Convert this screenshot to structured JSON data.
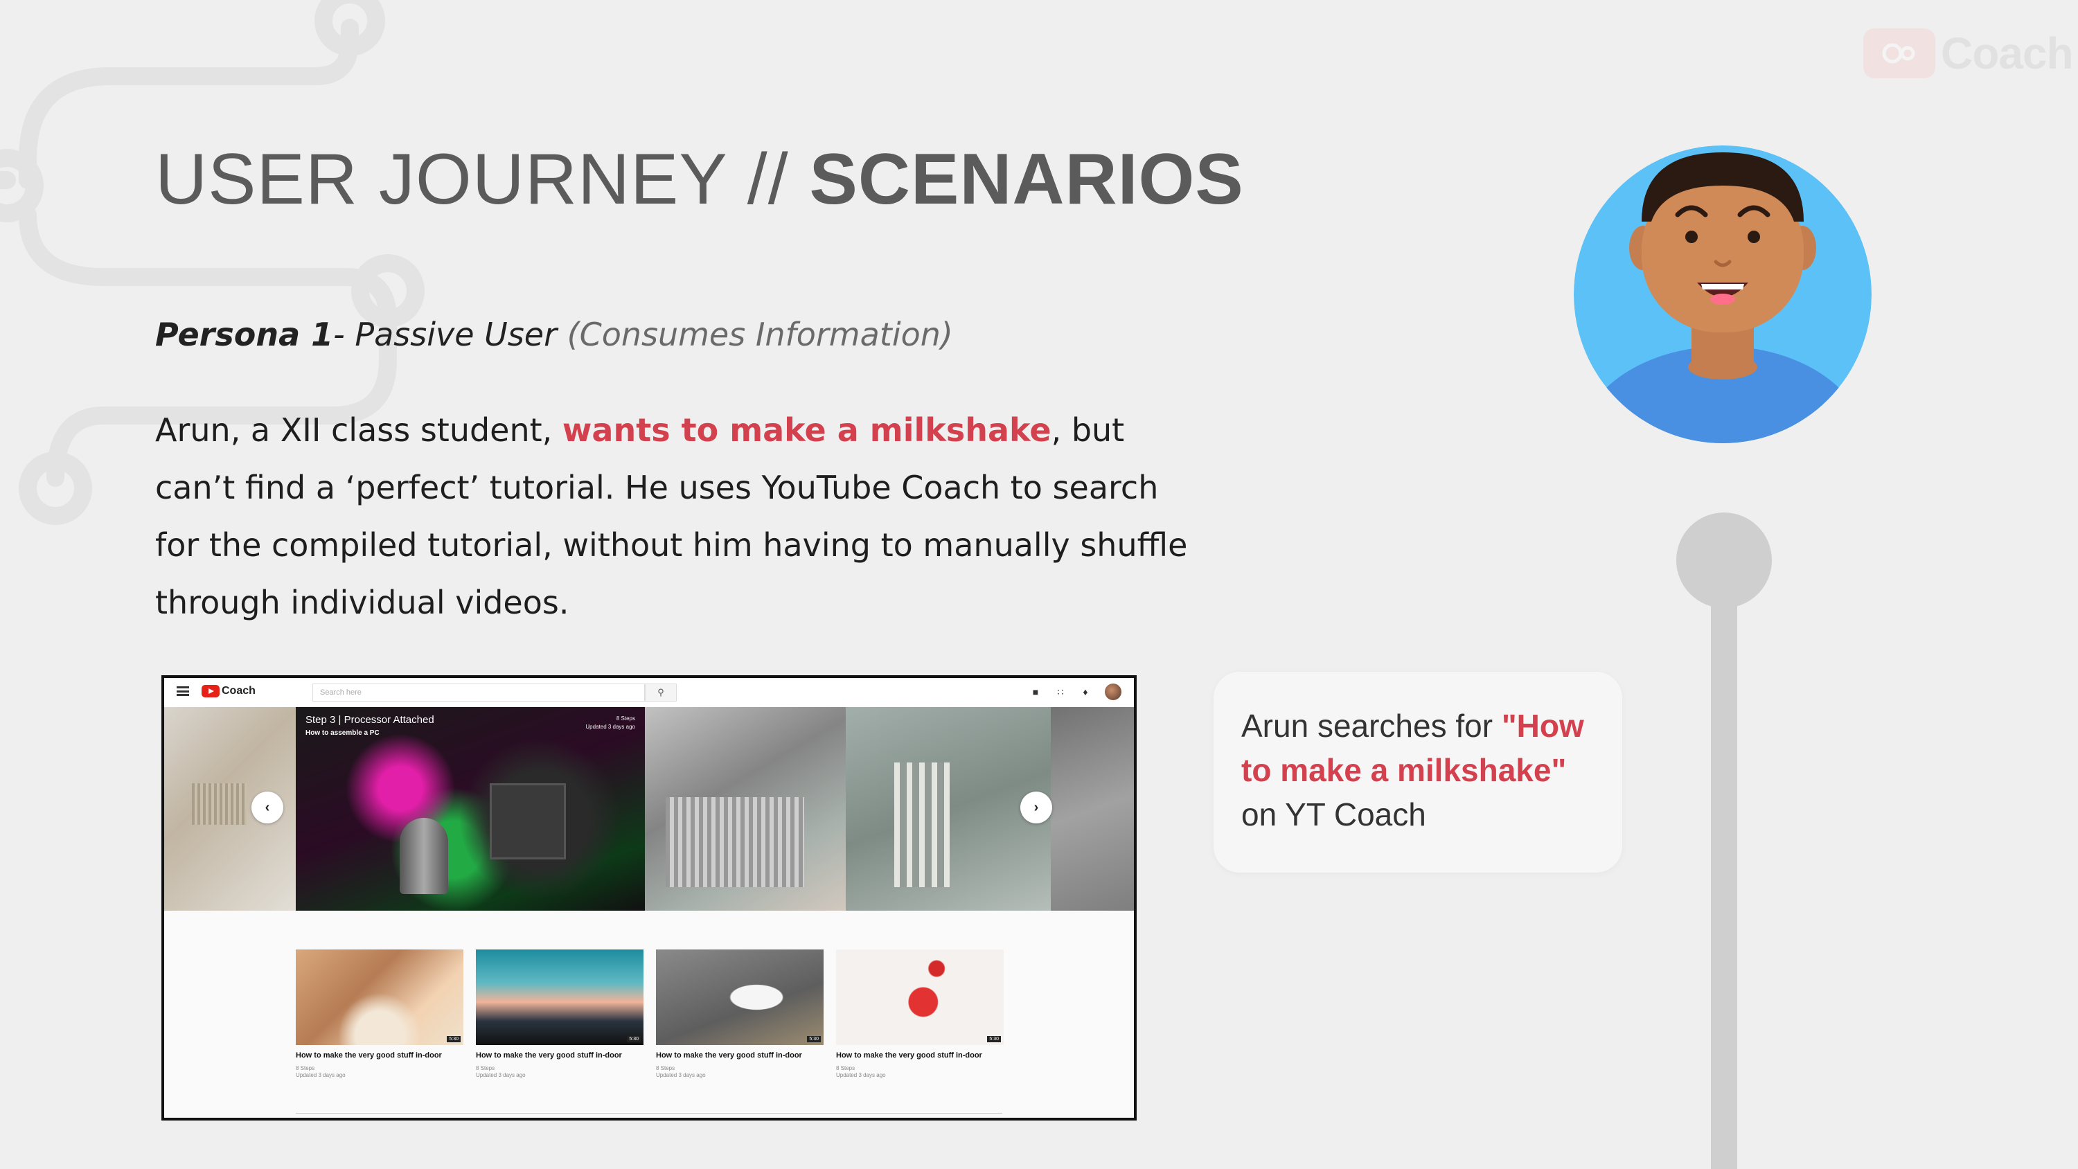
{
  "brand": {
    "name": "Coach",
    "icon": "gears-icon"
  },
  "title": {
    "part1": "USER JOURNEY // ",
    "part2": "SCENARIOS"
  },
  "persona": {
    "label": "Persona 1",
    "type": "- Passive User",
    "note": " (Consumes Information)"
  },
  "description": {
    "before": "Arun, a XII class student, ",
    "highlight": "wants to make a milkshake",
    "after": ", but can’t find a ‘perfect’ tutorial. He uses YouTube Coach to search for the compiled tutorial, without him having to manually shuffle through individual videos."
  },
  "mock": {
    "logo_text": "Coach",
    "search_placeholder": "Search here",
    "carousel": {
      "title": "Step 3 | Processor Attached",
      "subtitle": "How to assemble a PC",
      "steps": "8 Steps",
      "updated": "Updated 3 days ago"
    },
    "cards": [
      {
        "title": "How to make the very good stuff in-door",
        "steps": "8 Steps",
        "updated": "Updated 3 days ago",
        "duration": "5:30"
      },
      {
        "title": "How to make the very good stuff in-door",
        "steps": "8 Steps",
        "updated": "Updated 3 days ago",
        "duration": "5:30"
      },
      {
        "title": "How to make the very good stuff in-door",
        "steps": "8 Steps",
        "updated": "Updated 3 days ago",
        "duration": "5:30"
      },
      {
        "title": "How to make the very good stuff in-door",
        "steps": "8 Steps",
        "updated": "Updated 3 days ago",
        "duration": "5:30"
      }
    ]
  },
  "callout": {
    "before": "Arun searches for ",
    "highlight": "\"How to make a milkshake\"",
    "after": " on YT Coach"
  },
  "colors": {
    "accent": "#d3414e",
    "avatar_bg": "#5bc1f7",
    "timeline": "#cfcfcf"
  }
}
